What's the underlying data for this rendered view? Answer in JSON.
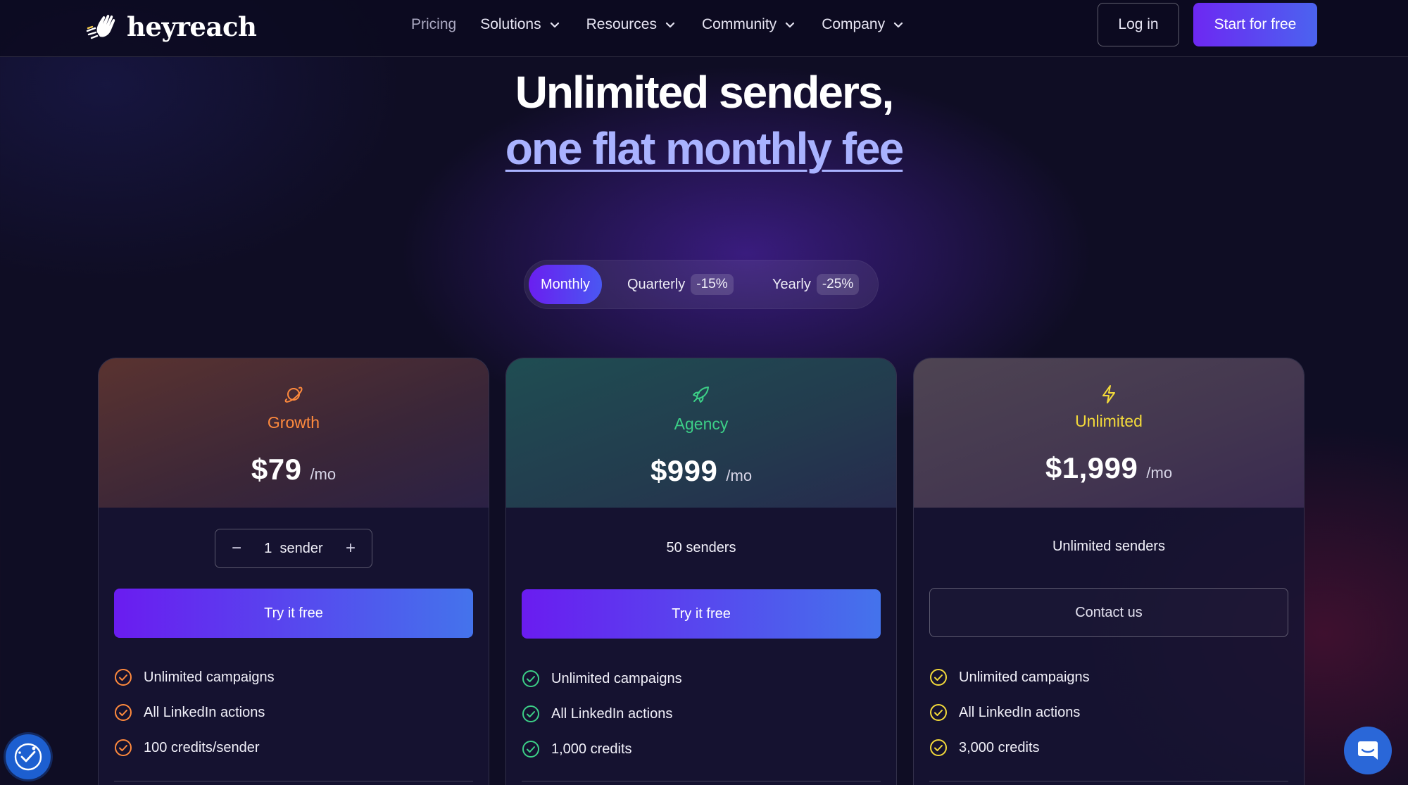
{
  "nav": {
    "logo_text": "heyreach",
    "menu": [
      {
        "label": "Pricing",
        "has_dropdown": false
      },
      {
        "label": "Solutions",
        "has_dropdown": true
      },
      {
        "label": "Resources",
        "has_dropdown": true
      },
      {
        "label": "Community",
        "has_dropdown": true
      },
      {
        "label": "Company",
        "has_dropdown": true
      }
    ],
    "login_label": "Log in",
    "start_label": "Start for free"
  },
  "hero": {
    "line1": "Unlimited senders,",
    "line2": "one flat monthly fee"
  },
  "billing_toggle": {
    "monthly": "Monthly",
    "quarterly": "Quarterly",
    "quarterly_discount": "-15%",
    "yearly": "Yearly",
    "yearly_discount": "-25%",
    "selected": "Monthly"
  },
  "plans": [
    {
      "name": "Growth",
      "icon": "planet-icon",
      "accent": "#ff8a3d",
      "price": "$79",
      "per": "/mo",
      "stepper": {
        "minus": "−",
        "value": "1  sender",
        "plus": "+"
      },
      "cta": "Try it free",
      "features": [
        "Unlimited campaigns",
        "All LinkedIn actions",
        "100 credits/sender"
      ]
    },
    {
      "name": "Agency",
      "icon": "rocket-icon",
      "accent": "#3ccf87",
      "price": "$999",
      "per": "/mo",
      "senders": "50 senders",
      "cta": "Try it free",
      "features": [
        "Unlimited campaigns",
        "All LinkedIn actions",
        "1,000 credits"
      ]
    },
    {
      "name": "Unlimited",
      "icon": "lightning-icon",
      "accent": "#f3da3a",
      "price": "$1,999",
      "per": "/mo",
      "senders": "Unlimited senders",
      "cta": "Contact us",
      "features": [
        "Unlimited campaigns",
        "All LinkedIn actions",
        "3,000 credits"
      ]
    }
  ],
  "colors": {
    "background": "#0f0d24",
    "primary_gradient_start": "#6a1cf0",
    "primary_gradient_end": "#4473ec",
    "hero_highlight": "#a9b2ff"
  }
}
